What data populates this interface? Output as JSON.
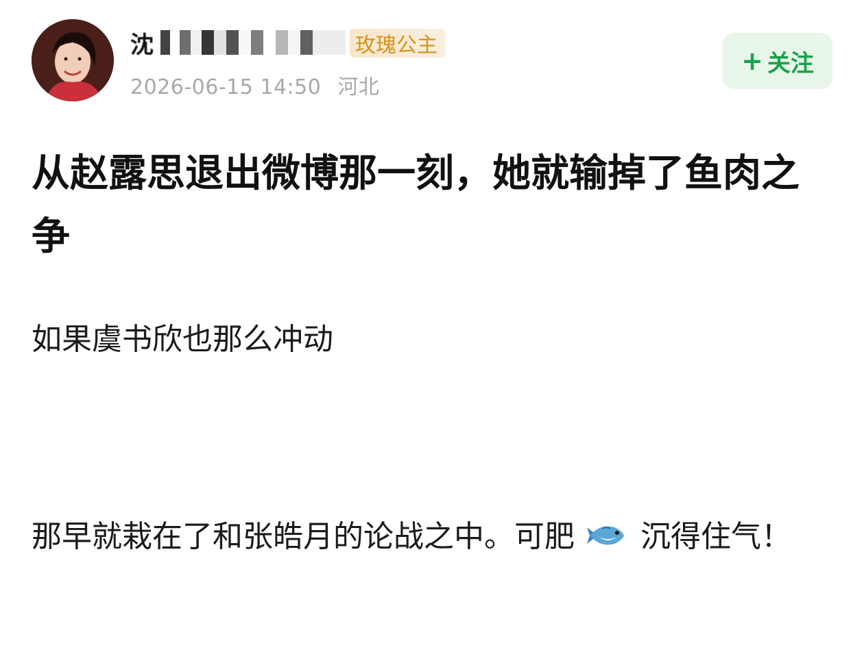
{
  "post": {
    "author_name_visible": "沈",
    "verified_tag": "玫瑰公主",
    "timestamp": "2026-06-15 14:50",
    "location": "河北",
    "follow_label": "关注",
    "follow_plus": "+",
    "title": "从赵露思退出微博那一刻，她就输掉了鱼肉之争",
    "paragraph_1": "如果虞书欣也那么冲动",
    "paragraph_2_a": "那早就栽在了和张皓月的论战之中。可肥",
    "paragraph_2_b": "沉得住气！",
    "fish_icon": "fish-icon"
  },
  "colors": {
    "follow_green": "#1aa34a",
    "follow_bg": "#e8f6ea",
    "meta_gray": "#a8a8a8",
    "tag_gold": "#d9921a"
  }
}
